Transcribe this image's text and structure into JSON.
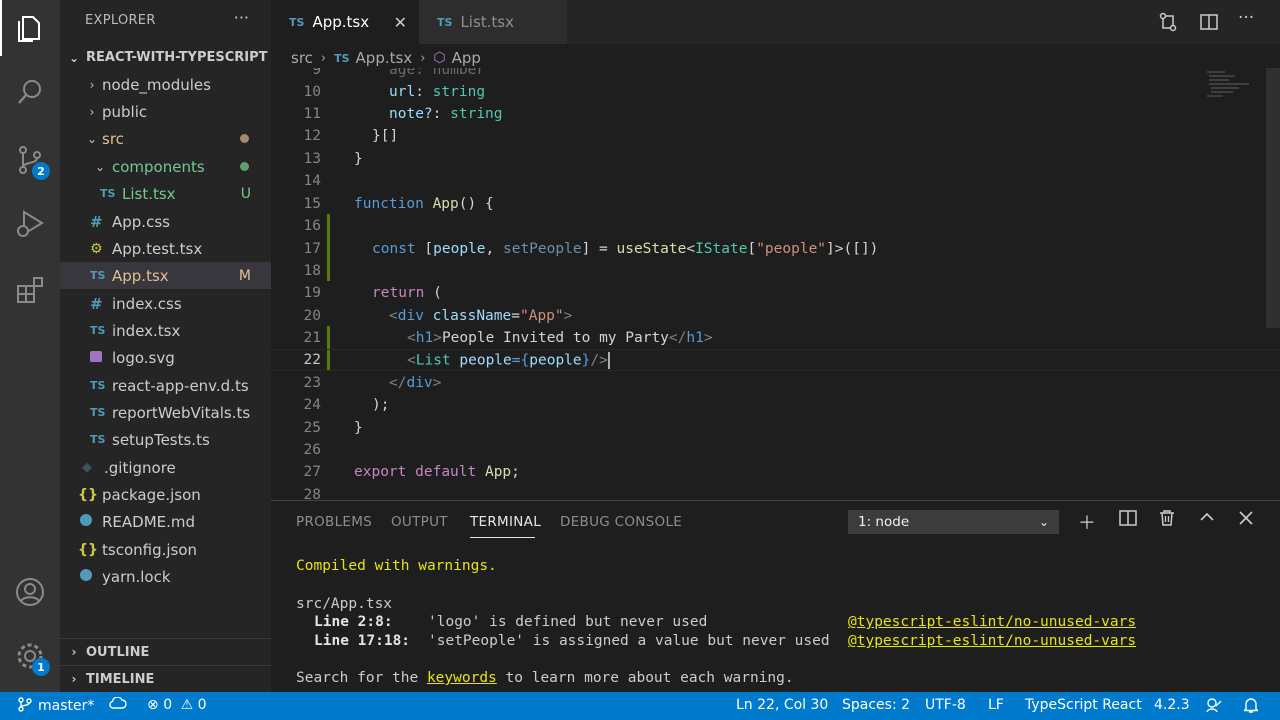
{
  "activity_bar": {
    "scm_badge": "2",
    "settings_badge": "1"
  },
  "explorer": {
    "title": "EXPLORER",
    "project": "REACT-WITH-TYPESCRIPT",
    "items": [
      {
        "label": "node_modules",
        "icon": "chevron-right"
      },
      {
        "label": "public",
        "icon": "chevron-right"
      },
      {
        "label": "src",
        "icon": "chevron-down"
      },
      {
        "label": "components",
        "icon": "chevron-down"
      },
      {
        "label": "List.tsx",
        "icon": "ts",
        "decoration": "U"
      },
      {
        "label": "App.css",
        "icon": "#"
      },
      {
        "label": "App.test.tsx",
        "icon": "gear"
      },
      {
        "label": "App.tsx",
        "icon": "ts",
        "decoration": "M"
      },
      {
        "label": "index.css",
        "icon": "#"
      },
      {
        "label": "index.tsx",
        "icon": "ts"
      },
      {
        "label": "logo.svg",
        "icon": "image"
      },
      {
        "label": "react-app-env.d.ts",
        "icon": "ts"
      },
      {
        "label": "reportWebVitals.ts",
        "icon": "ts"
      },
      {
        "label": "setupTests.ts",
        "icon": "ts"
      },
      {
        "label": ".gitignore",
        "icon": "git"
      },
      {
        "label": "package.json",
        "icon": "{}"
      },
      {
        "label": "README.md",
        "icon": "info"
      },
      {
        "label": "tsconfig.json",
        "icon": "{}"
      },
      {
        "label": "yarn.lock",
        "icon": "yarn"
      }
    ],
    "outline": "OUTLINE",
    "timeline": "TIMELINE"
  },
  "tabs": [
    {
      "label": "App.tsx",
      "prefix": "TS"
    },
    {
      "label": "List.tsx",
      "prefix": "TS"
    }
  ],
  "breadcrumb": {
    "folder": "src",
    "file_prefix": "TS",
    "file": "App.tsx",
    "symbol": "App"
  },
  "editor": {
    "line_numbers": [
      "9",
      "10",
      "11",
      "12",
      "13",
      "14",
      "15",
      "16",
      "17",
      "18",
      "19",
      "20",
      "21",
      "22",
      "23",
      "24",
      "25",
      "26",
      "27",
      "28"
    ],
    "lines": [
      [
        "age: number"
      ],
      [
        "url",
        ": ",
        "string"
      ],
      [
        "note?",
        ": ",
        "string"
      ],
      [
        "}[]"
      ],
      [
        "}"
      ],
      [
        ""
      ],
      [
        "function",
        " ",
        "App",
        "() {"
      ],
      [
        ""
      ],
      [
        "const",
        " [",
        "people",
        ", ",
        "setPeople",
        "] = ",
        "useState",
        "<",
        "IState",
        "[",
        "\"people\"",
        "]>([])"
      ],
      [
        ""
      ],
      [
        "return",
        " ("
      ],
      [
        "<",
        "div",
        " ",
        "className",
        "=",
        "\"App\"",
        ">"
      ],
      [
        "<",
        "h1",
        ">",
        "People Invited to my Party",
        "</",
        "h1",
        ">"
      ],
      [
        "<",
        "List",
        " ",
        "people",
        "={",
        "people",
        "}",
        "/>"
      ],
      [
        "</",
        "div",
        ">"
      ],
      [
        ");"
      ],
      [
        "}"
      ],
      [
        ""
      ],
      [
        "export",
        " ",
        "default",
        " ",
        "App",
        ";"
      ],
      [
        ""
      ]
    ]
  },
  "panel": {
    "tabs": [
      "PROBLEMS",
      "OUTPUT",
      "TERMINAL",
      "DEBUG CONSOLE"
    ],
    "terminal_select": "1: node",
    "terminal": {
      "line1": "Compiled with warnings.",
      "line2": "src/App.tsx",
      "w1_loc": "Line 2:8:",
      "w1_msg": "'logo' is defined but never used",
      "w1_rule": "@typescript-eslint/no-unused-vars",
      "w2_loc": "Line 17:18:",
      "w2_msg": "'setPeople' is assigned a value but never used",
      "w2_rule": "@typescript-eslint/no-unused-vars",
      "hint_pre": "Search for the ",
      "hint_link": "keywords",
      "hint_post": " to learn more about each warning."
    }
  },
  "status_bar": {
    "branch": "master*",
    "errors": "0",
    "warnings": "0",
    "position": "Ln 22, Col 30",
    "spaces": "Spaces: 2",
    "encoding": "UTF-8",
    "eol": "LF",
    "language": "TypeScript React",
    "version": "4.2.3"
  },
  "colors": {
    "accent": "#007acc",
    "modified": "#e2c08d",
    "untracked": "#73c991"
  }
}
